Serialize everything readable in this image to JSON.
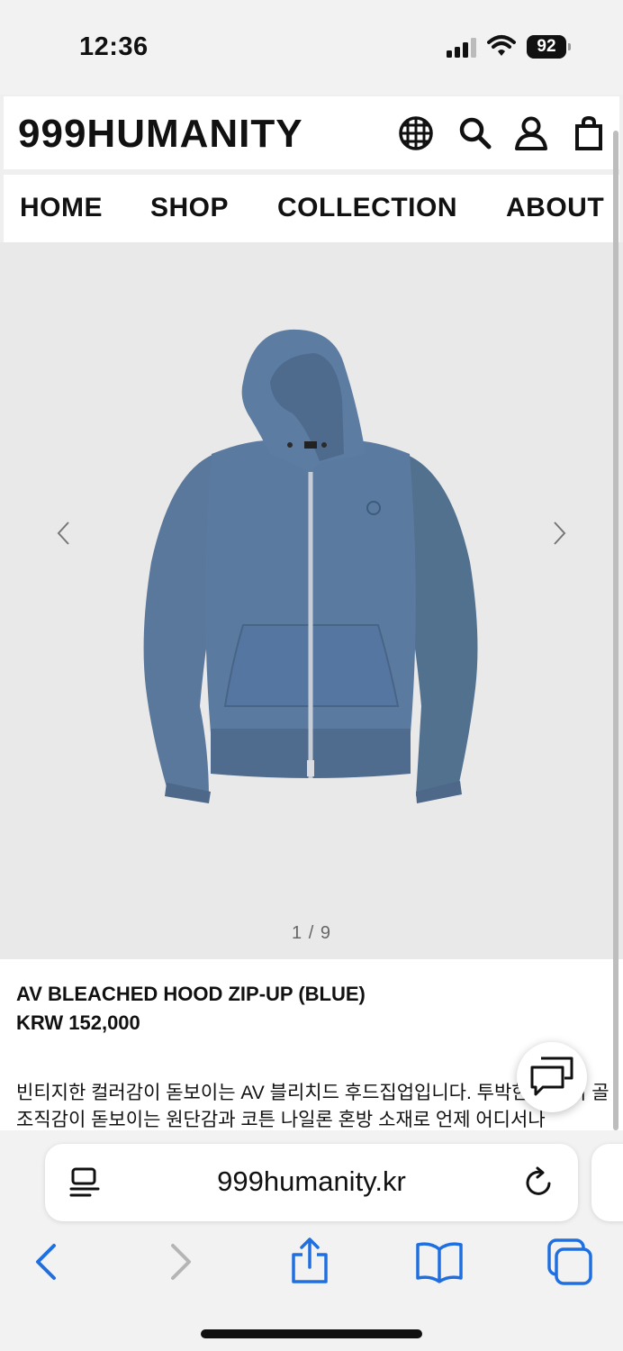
{
  "status_bar": {
    "time": "12:36",
    "battery": "92"
  },
  "header": {
    "logo": "999HUMANITY"
  },
  "nav": {
    "items": [
      "HOME",
      "SHOP",
      "COLLECTION",
      "ABOUT"
    ]
  },
  "gallery": {
    "counter": "1 / 9"
  },
  "product": {
    "name": "AV BLEACHED HOOD ZIP-UP (BLUE)",
    "price": "KRW 152,000",
    "description": "빈티지한 컬러감이 돋보이는 AV 블리치드 후드집업입니다. 투박한 와플의 골 조직감이 돋보이는 원단감과 코튼 나일론 혼방 소재로 언제 어디서나"
  },
  "browser": {
    "url": "999humanity.kr"
  },
  "colors": {
    "accent": "#1f6fe0",
    "hoodie": "#56759b"
  }
}
